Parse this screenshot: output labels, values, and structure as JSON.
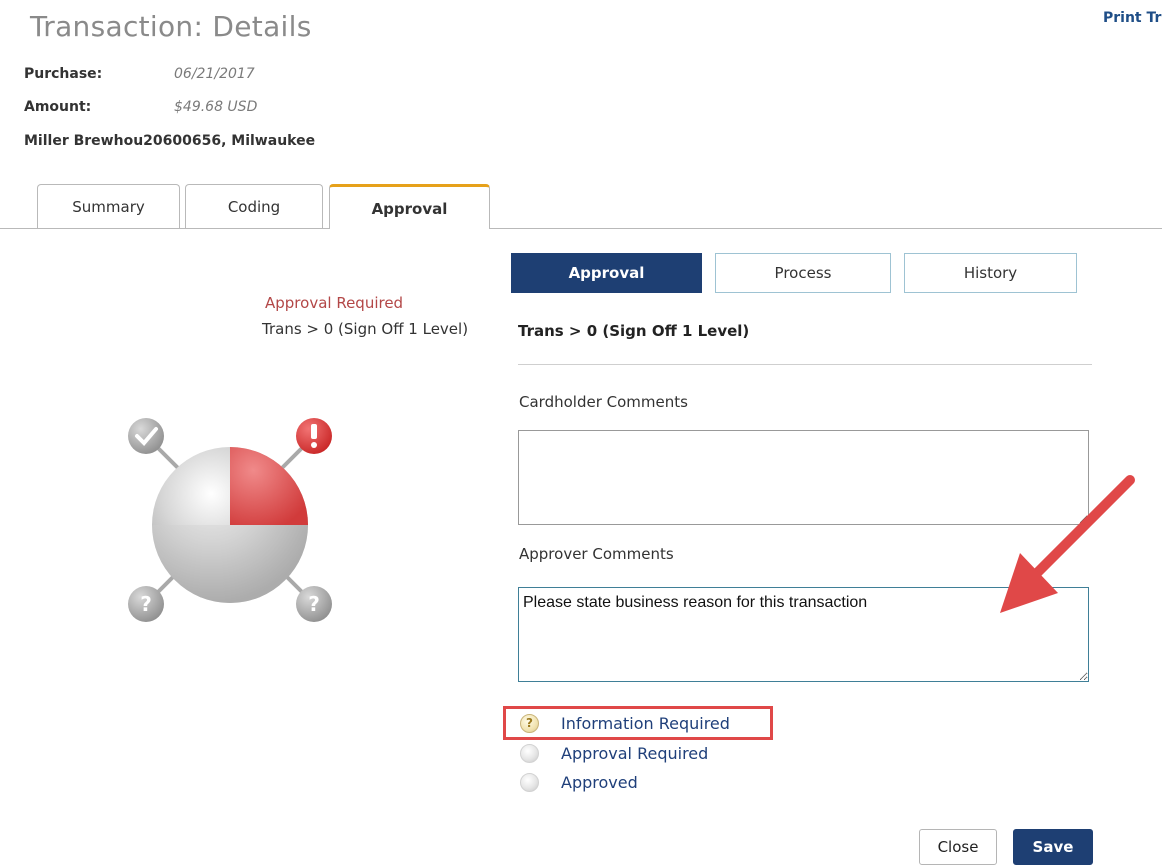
{
  "header": {
    "title": "Transaction: Details",
    "print_link": "Print Tr",
    "purchase_label": "Purchase:",
    "purchase_value": "06/21/2017",
    "amount_label": "Amount:",
    "amount_value": "$49.68 USD",
    "merchant": "Miller Brewhou20600656, Milwaukee"
  },
  "tabs": [
    {
      "label": "Summary",
      "active": false
    },
    {
      "label": "Coding",
      "active": false
    },
    {
      "label": "Approval",
      "active": true
    }
  ],
  "status": {
    "state": "Approval Required",
    "rule": "Trans > 0 (Sign Off 1 Level)"
  },
  "subtabs": [
    {
      "label": "Approval",
      "active": true
    },
    {
      "label": "Process",
      "active": false
    },
    {
      "label": "History",
      "active": false
    }
  ],
  "approval": {
    "rule_heading": "Trans > 0 (Sign Off 1 Level)",
    "cardholder_comments_label": "Cardholder Comments",
    "cardholder_comments_value": "",
    "approver_comments_label": "Approver Comments",
    "approver_comments_value": "Please state business reason for this transaction",
    "options": [
      {
        "label": "Information Required",
        "selected": true,
        "icon": "question-icon"
      },
      {
        "label": "Approval Required",
        "selected": false,
        "icon": "radio-empty"
      },
      {
        "label": "Approved",
        "selected": false,
        "icon": "radio-empty"
      }
    ]
  },
  "buttons": {
    "close": "Close",
    "save": "Save"
  },
  "colors": {
    "primary": "#1e3f73",
    "tab_accent": "#e6a11a",
    "alert_red": "#e04848",
    "status_text": "#b34747"
  }
}
